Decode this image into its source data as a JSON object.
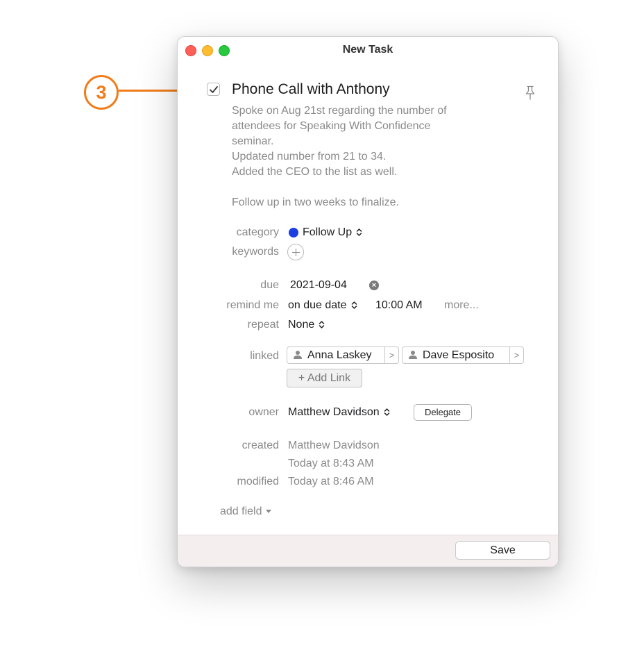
{
  "window": {
    "title": "New Task"
  },
  "task": {
    "title": "Phone Call with Anthony",
    "notes": "Spoke on Aug 21st regarding the number of\nattendees for Speaking With Confidence\nseminar.\nUpdated number from 21 to 34.\nAdded the CEO to the list as well.\n\nFollow up in two weeks to finalize.",
    "completed": true
  },
  "fields": {
    "category": {
      "label": "category",
      "value": "Follow Up",
      "color": "#1b3fe0"
    },
    "keywords": {
      "label": "keywords"
    },
    "due": {
      "label": "due",
      "value": "2021-09-04"
    },
    "remind": {
      "label": "remind me",
      "when": "on due date",
      "time": "10:00 AM",
      "more": "more..."
    },
    "repeat": {
      "label": "repeat",
      "value": "None"
    },
    "linked": {
      "label": "linked",
      "items": [
        "Anna Laskey",
        "Dave Esposito"
      ],
      "add_label": "+ Add Link"
    },
    "owner": {
      "label": "owner",
      "value": "Matthew Davidson",
      "delegate_label": "Delegate"
    },
    "created": {
      "label": "created",
      "by": "Matthew Davidson",
      "at": "Today at 8:43 AM"
    },
    "modified": {
      "label": "modified",
      "at": "Today at 8:46 AM"
    }
  },
  "add_field_label": "add field",
  "footer": {
    "save_label": "Save"
  },
  "callout": {
    "number": "3",
    "color": "#f07c1a"
  }
}
